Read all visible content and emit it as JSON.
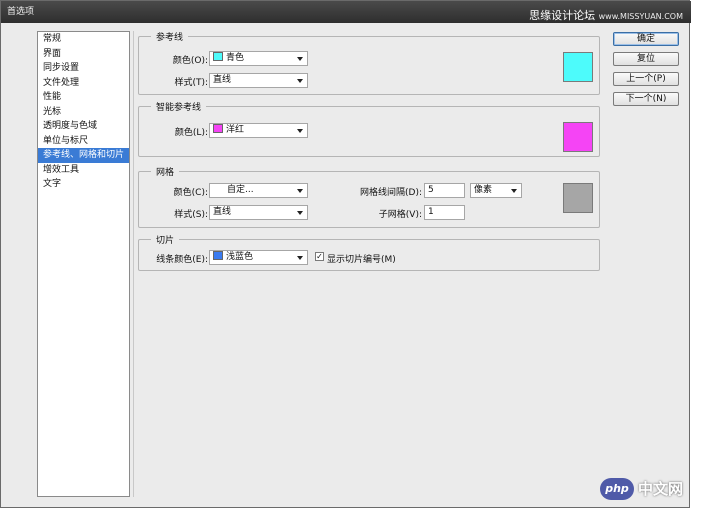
{
  "window": {
    "title": "首选项",
    "watermark": "思缘设计论坛",
    "watermark_url": "www.MISSYUAN.COM"
  },
  "categories": [
    {
      "label": "常规"
    },
    {
      "label": "界面"
    },
    {
      "label": "同步设置"
    },
    {
      "label": "文件处理"
    },
    {
      "label": "性能"
    },
    {
      "label": "光标"
    },
    {
      "label": "透明度与色域"
    },
    {
      "label": "单位与标尺"
    },
    {
      "label": "参考线、网格和切片"
    },
    {
      "label": "增效工具"
    },
    {
      "label": "文字"
    }
  ],
  "selected_category": 8,
  "guides": {
    "title": "参考线",
    "color_label": "颜色(O):",
    "color_value": "青色",
    "color_hex": "#4dfbfb",
    "style_label": "样式(T):",
    "style_value": "直线"
  },
  "smart_guides": {
    "title": "智能参考线",
    "color_label": "颜色(L):",
    "color_value": "洋红",
    "color_hex": "#f544f5"
  },
  "grid": {
    "title": "网格",
    "color_label": "颜色(C):",
    "color_value": "自定...",
    "color_hex": "#a6a6a6",
    "style_label": "样式(S):",
    "style_value": "直线",
    "gridline_label": "网格线间隔(D):",
    "gridline_value": "5",
    "gridline_unit": "像素",
    "subdiv_label": "子网格(V):",
    "subdiv_value": "1"
  },
  "slices": {
    "title": "切片",
    "line_color_label": "线条颜色(E):",
    "line_color_value": "浅蓝色",
    "line_color_hex": "#3a7bf0",
    "show_numbers_label": "显示切片编号(M)",
    "show_numbers_checked": "✓"
  },
  "buttons": {
    "ok": "确定",
    "reset": "复位",
    "prev": "上一个(P)",
    "next": "下一个(N)"
  },
  "footer": {
    "php": "php",
    "cn": "中文网"
  }
}
